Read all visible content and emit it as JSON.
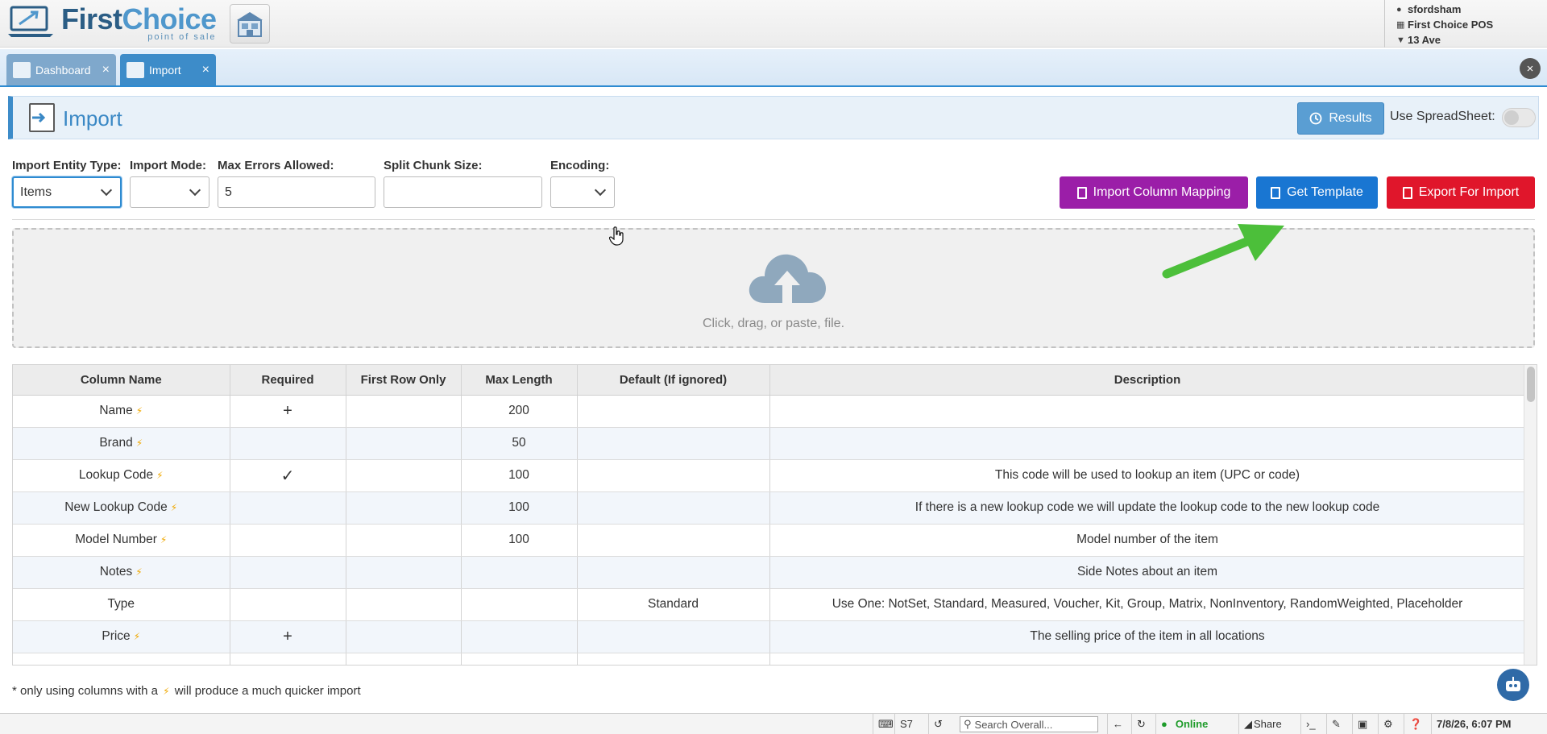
{
  "brand": {
    "name_first": "First",
    "name_second": "Choice",
    "tagline": "point of sale"
  },
  "user": {
    "username": "sfordsham",
    "store": "First Choice POS",
    "location": "13 Ave"
  },
  "tabs": [
    {
      "label": "Dashboard",
      "close": "×"
    },
    {
      "label": "Import",
      "close": "×"
    }
  ],
  "close_all": "×",
  "page": {
    "title": "Import",
    "results_label": "Results",
    "spreadsheet_label": "Use SpreadSheet:",
    "spreadsheet_on": false
  },
  "form": {
    "entity_type": {
      "label": "Import Entity Type:",
      "value": "Items"
    },
    "import_mode": {
      "label": "Import Mode:",
      "value": ""
    },
    "max_errors": {
      "label": "Max Errors Allowed:",
      "value": "5"
    },
    "split_chunk": {
      "label": "Split Chunk Size:",
      "value": ""
    },
    "encoding": {
      "label": "Encoding:",
      "value": ""
    }
  },
  "actions": {
    "mapping": "Import Column Mapping",
    "template": "Get Template",
    "export": "Export For Import"
  },
  "dropzone": {
    "text": "Click, drag, or paste, file."
  },
  "table": {
    "headers": [
      "Column Name",
      "Required",
      "First Row Only",
      "Max Length",
      "Default (If ignored)",
      "Description"
    ],
    "rows": [
      {
        "name": "Name",
        "bolt": true,
        "required": "+",
        "first_row": "",
        "max_length": "200",
        "default": "",
        "description": ""
      },
      {
        "name": "Brand",
        "bolt": true,
        "required": "",
        "first_row": "",
        "max_length": "50",
        "default": "",
        "description": ""
      },
      {
        "name": "Lookup Code",
        "bolt": true,
        "required": "✓",
        "first_row": "",
        "max_length": "100",
        "default": "",
        "description": "This code will be used to lookup an item (UPC or code)"
      },
      {
        "name": "New Lookup Code",
        "bolt": true,
        "required": "",
        "first_row": "",
        "max_length": "100",
        "default": "",
        "description": "If there is a new lookup code we will update the lookup code to the new lookup code"
      },
      {
        "name": "Model Number",
        "bolt": true,
        "required": "",
        "first_row": "",
        "max_length": "100",
        "default": "",
        "description": "Model number of the item"
      },
      {
        "name": "Notes",
        "bolt": true,
        "required": "",
        "first_row": "",
        "max_length": "",
        "default": "",
        "description": "Side Notes about an item"
      },
      {
        "name": "Type",
        "bolt": false,
        "required": "",
        "first_row": "",
        "max_length": "",
        "default": "Standard",
        "description": "Use One: NotSet, Standard, Measured, Voucher, Kit, Group, Matrix, NonInventory, RandomWeighted, Placeholder"
      },
      {
        "name": "Price",
        "bolt": true,
        "required": "+",
        "first_row": "",
        "max_length": "",
        "default": "",
        "description": "The selling price of the item in all locations"
      }
    ]
  },
  "footnote": {
    "before": "* only using columns with a",
    "bolt": "⚡",
    "after": "will produce a much quicker import"
  },
  "status": {
    "s7": "S7",
    "search_placeholder": "Search Overall...",
    "online": "Online",
    "share": "Share",
    "datetime": "7/8/26, 6:07 PM"
  }
}
